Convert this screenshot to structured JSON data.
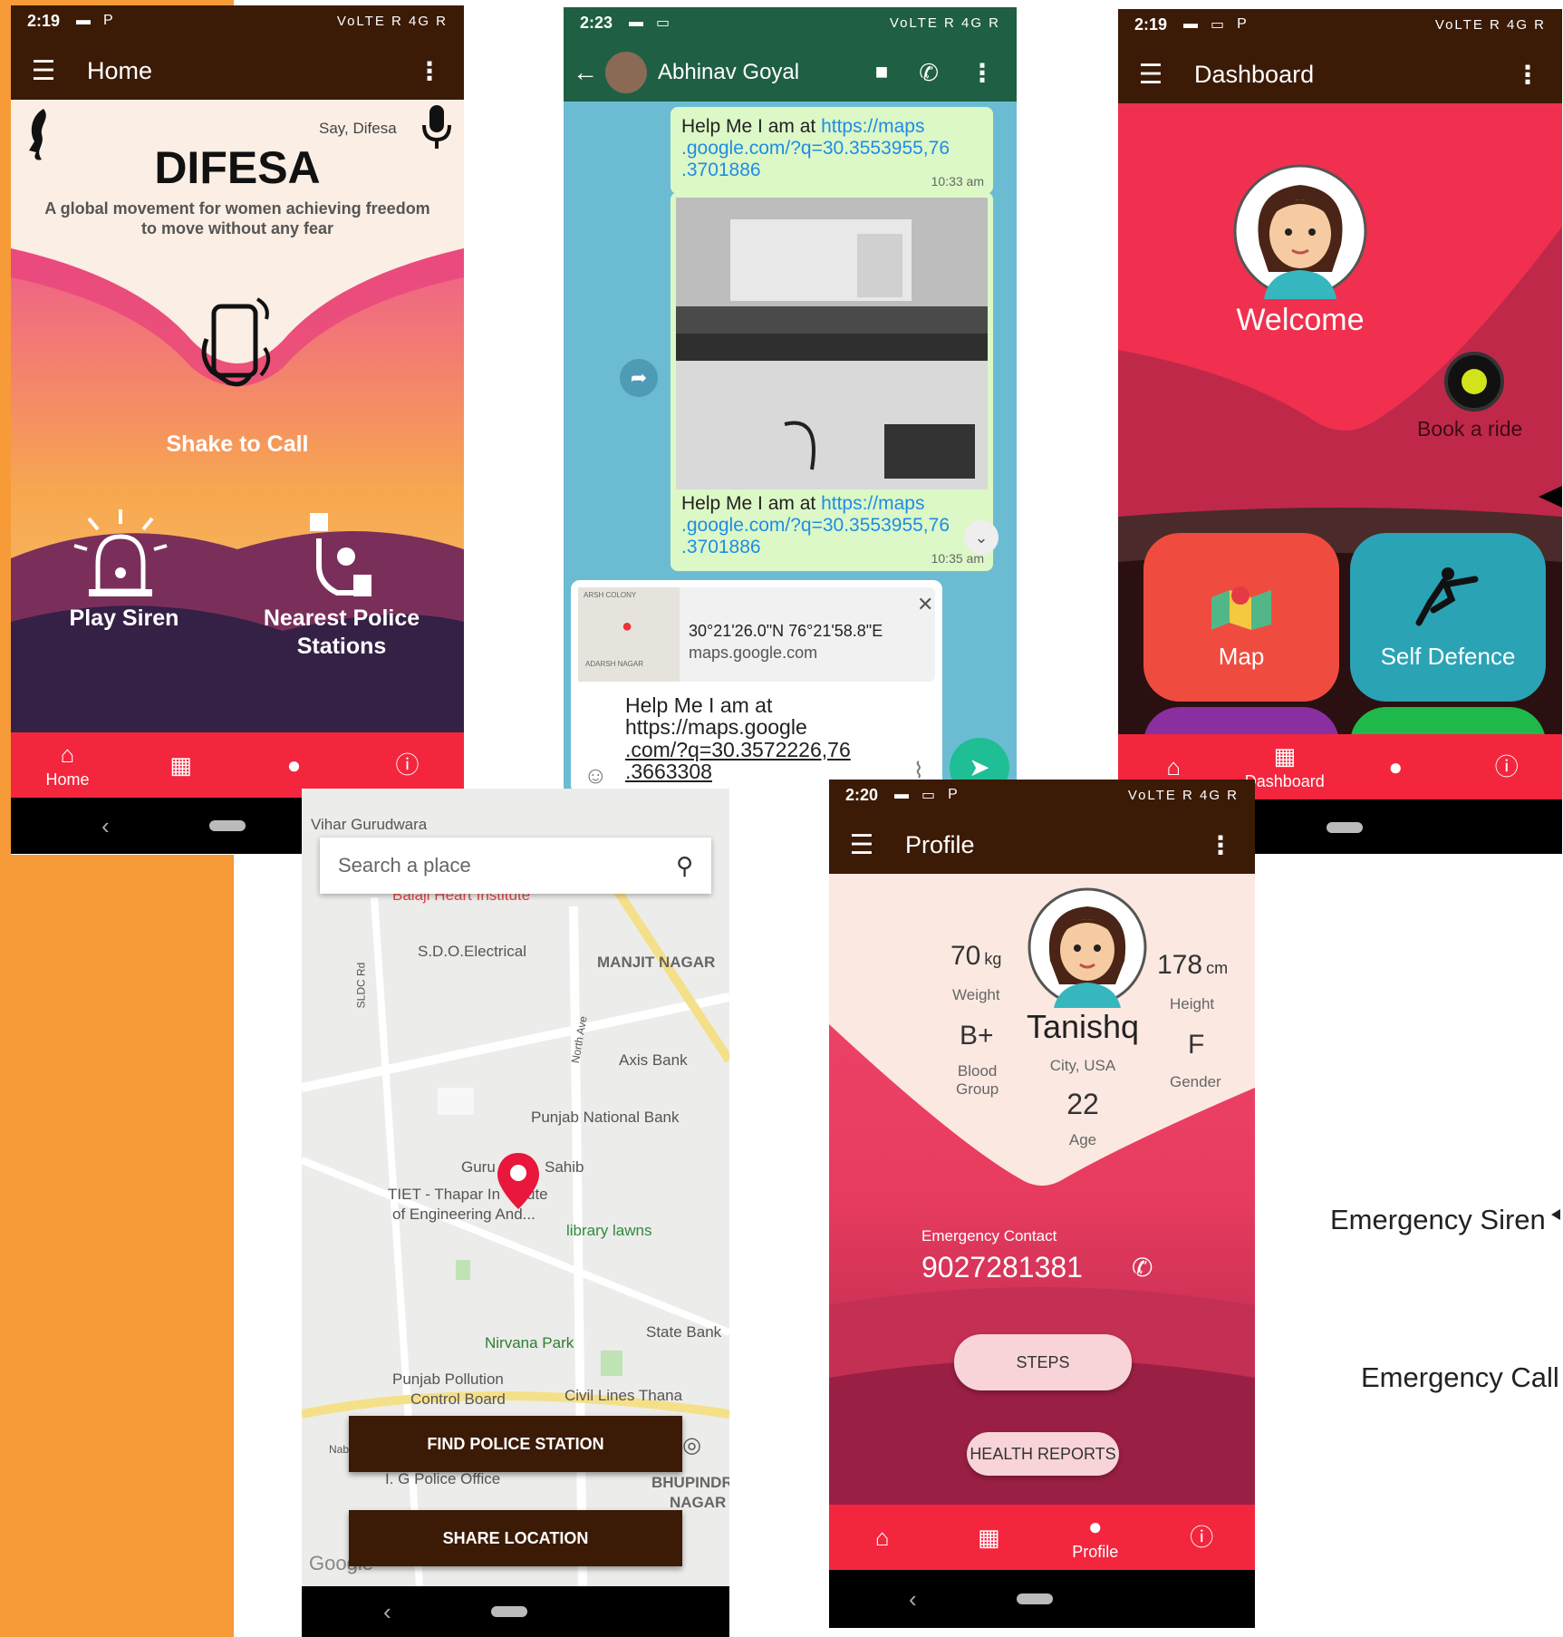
{
  "colors": {
    "orange": "#f79a38",
    "dark_brown": "#3b1a06",
    "red": "#f3263e",
    "teal": "#6bbcd3",
    "bubble": "#dcf8c6"
  },
  "home": {
    "status": {
      "time": "2:19",
      "signal": "VoLTE R 4G R"
    },
    "title": "Home",
    "say": "Say, Difesa",
    "brand": "DIFESA",
    "tagline_1": "A global movement for women achieving freedom",
    "tagline_2": "to move without any fear",
    "shake": "Shake to Call",
    "siren": "Play Siren",
    "police_1": "Nearest Police",
    "police_2": "Stations",
    "nav": {
      "home": "Home"
    }
  },
  "chat": {
    "status": {
      "time": "2:23",
      "signal": "VoLTE R 4G R"
    },
    "contact": "Abhinav Goyal",
    "msg1": {
      "prefix": "Help Me I am at ",
      "link_1": "https://maps",
      ".link_2": "",
      ".": "",
      "link_b": ".google.com/?q=30.3553955,76",
      "link_c": ".3701886",
      "time": "10:33 am"
    },
    "msg2": {
      "prefix": "Help Me I am at ",
      "link_1": "https://maps",
      "link_b": ".google.com/?q=30.3553955,76",
      "link_c": ".3701886",
      "time": "10:35 am"
    },
    "preview": {
      "coords": "30°21'26.0\"N 76°21'58.8\"E",
      "site": "maps.google.com",
      "map_top": "ARSH COLONY",
      "map_bottom": "ADARSH NAGAR"
    },
    "compose": {
      "line1": "Help Me I am at",
      "line2": "https://maps.google",
      "line3": ".com/?q=30.3572226,76",
      "line4": ".3663308"
    }
  },
  "dashboard": {
    "status": {
      "time": "2:19",
      "signal": "VoLTE R 4G R"
    },
    "title": "Dashboard",
    "welcome": "Welcome",
    "ride": "Book a ride",
    "tiles": {
      "map": "Map",
      "self_defence": "Self Defence"
    },
    "nav": {
      "dashboard": "Dashboard"
    }
  },
  "map": {
    "search_placeholder": "Search a place",
    "labels": {
      "vihar": "Vihar Gurudwara",
      "balaji": "Balaji Heart Institute",
      "sdo": "S.D.O.Electrical",
      "manjit": "MANJIT NAGAR",
      "axis": "Axis Bank",
      "pnb": "Punjab National Bank",
      "guru": "Guru",
      "sahib": "Sahib",
      "tiet_1": "TIET - Thapar In",
      "tiet_1b": "ute",
      "tiet_2": "of Engineering And...",
      "library": "library lawns",
      "nirvana": "Nirvana Park",
      "state": "State Bank",
      "ppcb_1": "Punjab Pollution",
      "ppcb_2": "Control Board",
      "civil": "Civil Lines Thana",
      "ig": "I. G Police Office",
      "bhup_1": "BHUPINDR",
      "bhup_2": "NAGAR",
      "sldc": "SLDC Rd",
      "north": "North Ave",
      "nab": "Nab",
      "google": "Google"
    },
    "btn_find": "FIND POLICE STATION",
    "btn_share": "SHARE LOCATION"
  },
  "profile": {
    "status": {
      "time": "2:20",
      "signal": "VoLTE R 4G R"
    },
    "title": "Profile",
    "weight_value": "70",
    "weight_unit": "kg",
    "weight_label": "Weight",
    "height_value": "178",
    "height_unit": "cm",
    "height_label": "Height",
    "blood_value": "B+",
    "blood_label_1": "Blood",
    "blood_label_2": "Group",
    "gender_value": "F",
    "gender_label": "Gender",
    "name": "Tanishq",
    "city": "City, USA",
    "age_value": "22",
    "age_label": "Age",
    "contact_label": "Emergency Contact",
    "contact_number": "9027281381",
    "steps": "STEPS",
    "health": "HEALTH REPORTS",
    "nav": {
      "profile": "Profile"
    }
  },
  "side": {
    "siren": "Emergency Siren",
    "call": "Emergency Call"
  }
}
